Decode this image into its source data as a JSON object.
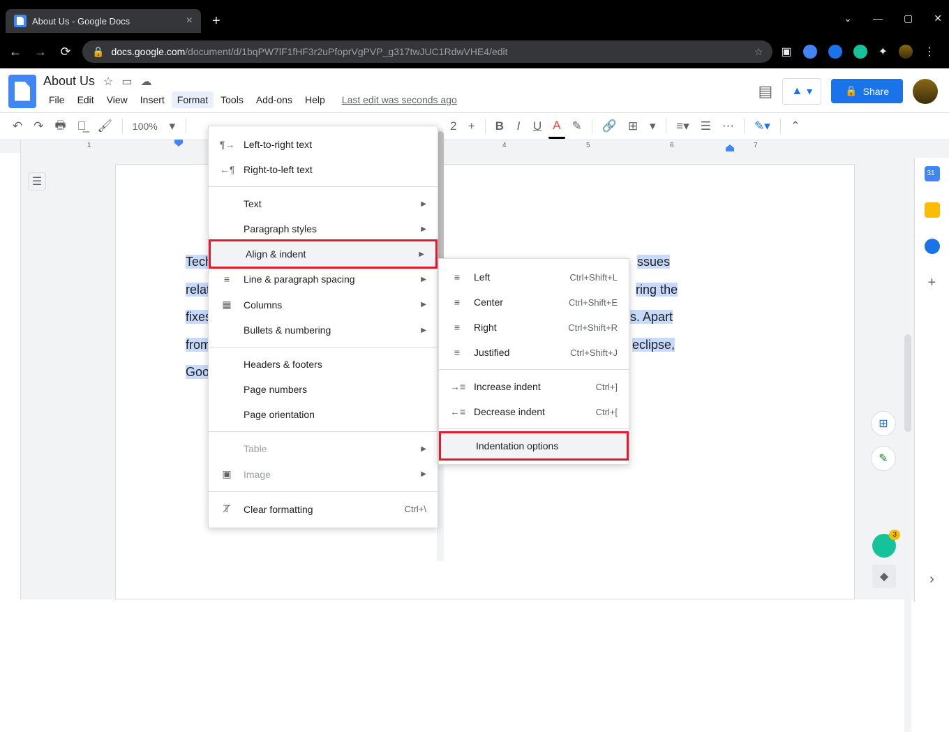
{
  "browser": {
    "tab_title": "About Us - Google Docs",
    "url_host": "docs.google.com",
    "url_path": "/document/d/1bqPW7lF1fHF3r2uPfoprVgPVP_g317twJUC1RdwVHE4/edit"
  },
  "doc": {
    "title": "About Us",
    "menus": [
      "File",
      "Edit",
      "View",
      "Insert",
      "Format",
      "Tools",
      "Add-ons",
      "Help"
    ],
    "last_edit": "Last edit was seconds ago",
    "share_label": "Share"
  },
  "toolbar": {
    "zoom": "100%",
    "font_size": "2"
  },
  "ruler": {
    "nums": [
      "1",
      "4",
      "5",
      "6",
      "7"
    ]
  },
  "document_text": {
    "line1a": "Techcu",
    "line1b": "ssues",
    "line2a": "related",
    "line2b": "ring the",
    "line3a": "fixes fo",
    "line3b": "s. Apart",
    "line4a": "from th",
    "line4b": "eclipse,",
    "line5a": "Google"
  },
  "format_menu": {
    "ltr": "Left-to-right text",
    "rtl": "Right-to-left text",
    "text": "Text",
    "paragraph_styles": "Paragraph styles",
    "align_indent": "Align & indent",
    "line_spacing": "Line & paragraph spacing",
    "columns": "Columns",
    "bullets": "Bullets & numbering",
    "headers_footers": "Headers & footers",
    "page_numbers": "Page numbers",
    "page_orientation": "Page orientation",
    "table": "Table",
    "image": "Image",
    "clear_formatting": "Clear formatting",
    "clear_shortcut": "Ctrl+\\"
  },
  "align_submenu": {
    "left": "Left",
    "left_sc": "Ctrl+Shift+L",
    "center": "Center",
    "center_sc": "Ctrl+Shift+E",
    "right": "Right",
    "right_sc": "Ctrl+Shift+R",
    "justified": "Justified",
    "justified_sc": "Ctrl+Shift+J",
    "increase": "Increase indent",
    "increase_sc": "Ctrl+]",
    "decrease": "Decrease indent",
    "decrease_sc": "Ctrl+[",
    "indent_options": "Indentation options"
  }
}
